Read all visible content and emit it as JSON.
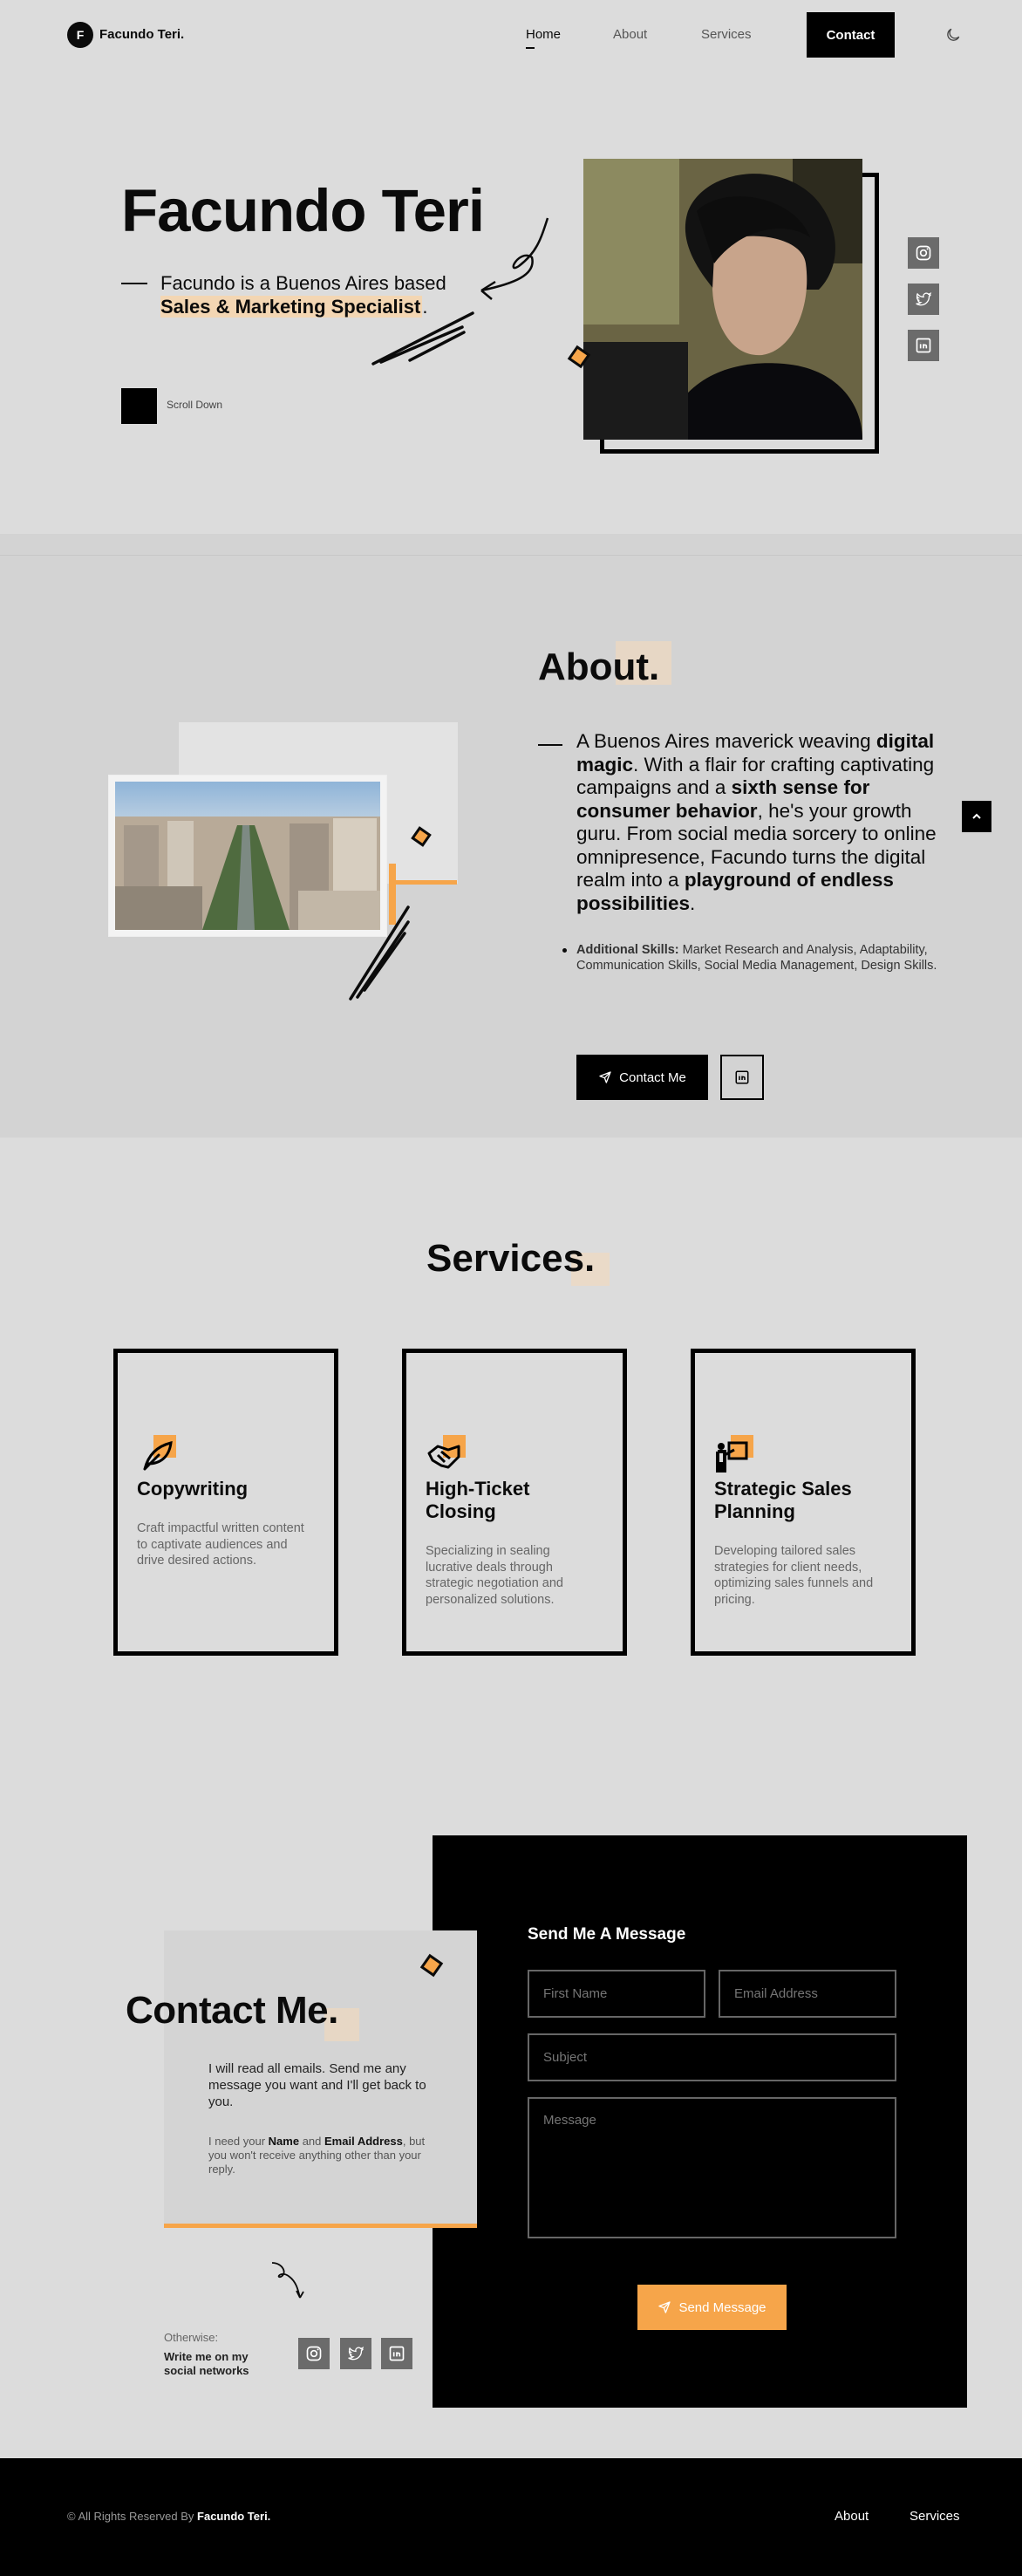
{
  "nav": {
    "logo_letter": "F",
    "logo_text": "Facundo Teri.",
    "links": [
      "Home",
      "About",
      "Services"
    ],
    "contact_label": "Contact",
    "theme_icon": "moon-icon"
  },
  "hero": {
    "title": "Facundo Teri",
    "subtitle_plain": "Facundo is a Buenos Aires based",
    "subtitle_highlight": "Sales & Marketing Specialist",
    "subtitle_end": ".",
    "scroll_label": "Scroll Down",
    "social_icons": [
      "instagram-icon",
      "twitter-icon",
      "linkedin-icon"
    ]
  },
  "about": {
    "title": "About.",
    "text_parts": [
      {
        "t": "A Buenos Aires maverick weaving ",
        "b": false
      },
      {
        "t": "digital magic",
        "b": true
      },
      {
        "t": ". With a flair for crafting captivating campaigns and a ",
        "b": false
      },
      {
        "t": "sixth sense for consumer behavior",
        "b": true
      },
      {
        "t": ", he's your growth guru. From social media sorcery to online omnipresence, Facundo turns the digital realm into a ",
        "b": false
      },
      {
        "t": "playground of endless possibilities",
        "b": true
      },
      {
        "t": ".",
        "b": false
      }
    ],
    "skills_label": "Additional Skills:",
    "skills_text": " Market Research and Analysis, Adaptability, Communication Skills, Social Media Management, Design Skills.",
    "contact_button": "Contact Me"
  },
  "services": {
    "title": "Services.",
    "cards": [
      {
        "title": "Copywriting",
        "desc": "Craft impactful written content to captivate audiences and drive desired actions.",
        "icon": "feather-icon"
      },
      {
        "title": "High-Ticket Closing",
        "desc": "Specializing in sealing lucrative deals through strategic negotiation and personalized solutions.",
        "icon": "handshake-icon"
      },
      {
        "title": "Strategic Sales Planning",
        "desc": "Developing tailored sales strategies for client needs, optimizing sales funnels and pricing.",
        "icon": "presentation-icon"
      }
    ]
  },
  "contact": {
    "title": "Contact Me.",
    "p1": "I will read all emails. Send me any message you want and I'll get back to you.",
    "p2_a": "I need your ",
    "p2_name": "Name",
    "p2_and": " and ",
    "p2_email": "Email Address",
    "p2_b": ", but you won't receive anything other than your reply.",
    "otherwise": "Otherwise:",
    "write_me": "Write me on my social networks",
    "form_title": "Send Me A Message",
    "first_name_placeholder": "First Name",
    "email_placeholder": "Email Address",
    "subject_placeholder": "Subject",
    "message_placeholder": "Message",
    "send_label": "Send Message"
  },
  "footer": {
    "copyright": "© All Rights Reserved By ",
    "owner": "Facundo Teri.",
    "links": [
      "About",
      "Services"
    ]
  },
  "colors": {
    "accent": "#f6a54a",
    "black": "#000000",
    "background": "#dcdcdc",
    "highlight": "#f0d9bf"
  }
}
